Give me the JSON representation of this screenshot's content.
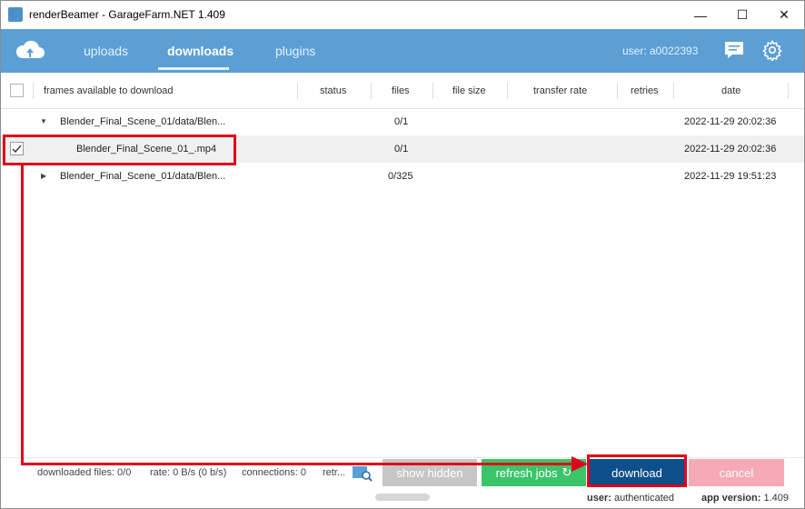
{
  "window": {
    "title": "renderBeamer - GarageFarm.NET 1.409",
    "controls": {
      "minimize": "—",
      "maximize": "☐",
      "close": "✕"
    }
  },
  "nav": {
    "tabs": [
      {
        "label": "uploads",
        "active": false
      },
      {
        "label": "downloads",
        "active": true
      },
      {
        "label": "plugins",
        "active": false
      }
    ],
    "user": "user: a0022393"
  },
  "table": {
    "columns": [
      "frames available to download",
      "status",
      "files",
      "file size",
      "transfer rate",
      "retries",
      "date"
    ],
    "rows": [
      {
        "name": "Blender_Final_Scene_01/data/Blen...",
        "status": "",
        "files": "0/1",
        "file_size": "",
        "transfer_rate": "",
        "retries": "",
        "date": "2022-11-29 20:02:36",
        "expanded": true,
        "checked": false
      },
      {
        "name": "Blender_Final_Scene_01_.mp4",
        "status": "",
        "files": "0/1",
        "file_size": "",
        "transfer_rate": "",
        "retries": "",
        "date": "2022-11-29 20:02:36",
        "checked": true
      },
      {
        "name": "Blender_Final_Scene_01/data/Blen...",
        "status": "",
        "files": "0/325",
        "file_size": "",
        "transfer_rate": "",
        "retries": "",
        "date": "2022-11-29 19:51:23",
        "expanded": false,
        "checked": false
      }
    ]
  },
  "status": {
    "downloaded_files": "downloaded files: 0/0",
    "rate": "rate: 0 B/s (0 b/s)",
    "connections": "connections: 0",
    "retries": "retr..."
  },
  "buttons": {
    "show_hidden": "show hidden",
    "refresh_jobs": "refresh jobs",
    "download": "download",
    "cancel": "cancel"
  },
  "footer": {
    "user_label": "user:",
    "user_value": "authenticated",
    "version_label": "app version:",
    "version_value": "1.409"
  },
  "colors": {
    "nav_bg": "#5b9fd5",
    "download_button": "#0e4e8a",
    "refresh_button": "#3cc46a",
    "cancel_button": "#f5aab6",
    "show_hidden_button": "#c6c6c6",
    "annotation_red": "#e0001b"
  }
}
